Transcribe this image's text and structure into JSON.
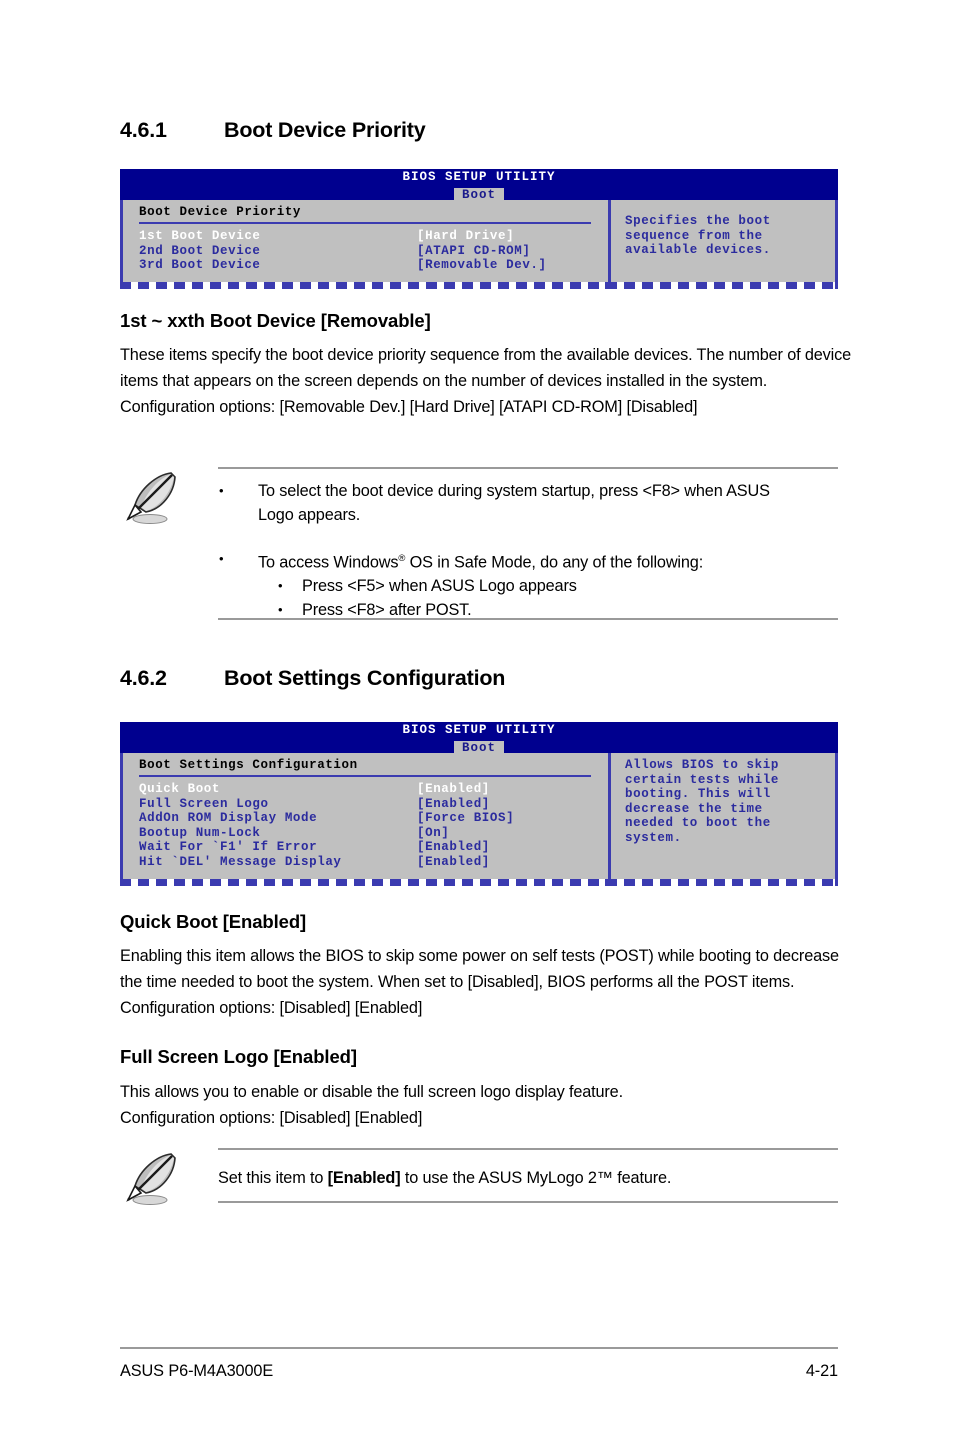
{
  "document": {
    "footer_left": "ASUS P6-M4A3000E",
    "footer_right": "4-21"
  },
  "section_461": {
    "number": "4.6.1",
    "title": "Boot Device Priority",
    "bios": {
      "utility_title": "BIOS SETUP UTILITY",
      "tab": "Boot",
      "panel_title": "Boot Device Priority",
      "rows": [
        {
          "label": "1st Boot Device",
          "value": "[Hard Drive]",
          "selected": true
        },
        {
          "label": "2nd Boot Device",
          "value": "[ATAPI CD-ROM]",
          "selected": false
        },
        {
          "label": "3rd Boot Device",
          "value": "[Removable Dev.]",
          "selected": false
        }
      ],
      "help": "Specifies the boot\nsequence from the\navailable devices."
    },
    "sub_heading": "1st ~ xxth Boot Device [Removable]",
    "paragraph": "These items specify the boot device priority sequence from the available devices. The number of device items that appears on the screen depends on the number of devices installed in the system.\nConfiguration options: [Removable Dev.] [Hard Drive] [ATAPI CD-ROM] [Disabled]",
    "note": {
      "icon": "quill-pen-icon",
      "bullet1_a": "To select the boot device during system startup, press <F8> when ASUS",
      "bullet1_b": "Logo appears.",
      "bullet2_pre": "To access Windows",
      "bullet2_post": " OS in Safe Mode, do any of the following:",
      "bullet2_sub1": "Press <F5> when ASUS Logo appears",
      "bullet2_sub2": "Press <F8> after POST."
    }
  },
  "section_462": {
    "number": "4.6.2",
    "title": "Boot Settings Configuration",
    "bios": {
      "utility_title": "BIOS SETUP UTILITY",
      "tab": "Boot",
      "panel_title": "Boot Settings Configuration",
      "rows": [
        {
          "label": "Quick Boot",
          "value": "[Enabled]",
          "selected": true
        },
        {
          "label": "Full Screen Logo",
          "value": "[Enabled]",
          "selected": false
        },
        {
          "label": "AddOn ROM Display Mode",
          "value": "[Force BIOS]",
          "selected": false
        },
        {
          "label": "Bootup Num-Lock",
          "value": "[On]",
          "selected": false
        },
        {
          "label": "Wait For `F1' If Error",
          "value": "[Enabled]",
          "selected": false
        },
        {
          "label": "Hit `DEL' Message Display",
          "value": "[Enabled]",
          "selected": false
        }
      ],
      "help": "Allows BIOS to skip\ncertain tests while\nbooting. This will\ndecrease the time\nneeded to boot the\nsystem."
    },
    "quick_boot": {
      "heading": "Quick Boot [Enabled]",
      "paragraph": "Enabling this item allows the BIOS to skip some power on self tests (POST) while booting to decrease the time needed to boot the system. When set to [Disabled], BIOS performs all the POST items. Configuration options: [Disabled] [Enabled]"
    },
    "full_screen_logo": {
      "heading": "Full Screen Logo [Enabled]",
      "paragraph": "This allows you to enable or disable the full screen logo display feature.\nConfiguration options: [Disabled] [Enabled]"
    },
    "note": {
      "icon": "quill-pen-icon",
      "text_pre": "Set this item to ",
      "text_bold": "[Enabled]",
      "text_post": " to use the ASUS MyLogo 2™ feature."
    }
  },
  "colors": {
    "bios_title_bg": "#00008f",
    "bios_panel_bg": "#c0c0c0",
    "bios_border": "#3b3bb0",
    "bios_text": "#2b2b9e",
    "bios_selected_text": "#ffffff",
    "rule_gray": "#9a9a9a"
  }
}
